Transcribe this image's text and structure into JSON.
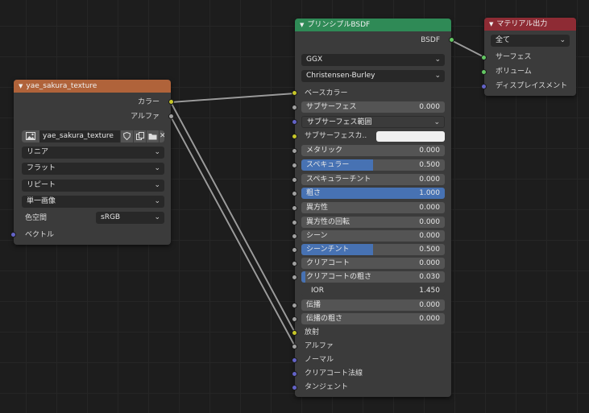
{
  "image_node": {
    "title": "yae_sakura_texture",
    "header_color": "#b0633a",
    "out_color": "カラー",
    "out_alpha": "アルファ",
    "image_name": "yae_sakura_texture",
    "interpolation": "リニア",
    "projection": "フラット",
    "extension": "リピート",
    "source": "単一画像",
    "color_space_label": "色空間",
    "color_space": "sRGB",
    "in_vector": "ベクトル"
  },
  "bsdf_node": {
    "title": "プリンシプルBSDF",
    "header_color": "#2f8a56",
    "out_bsdf": "BSDF",
    "distribution": "GGX",
    "subsurface_method": "Christensen-Burley",
    "base_color": "ベースカラー",
    "subsurface": {
      "label": "サブサーフェス",
      "value": "0.000"
    },
    "subsurface_radius": "サブサーフェス範囲",
    "subsurface_color": "サブサーフェスカ..",
    "metallic": {
      "label": "メタリック",
      "value": "0.000"
    },
    "specular": {
      "label": "スペキュラー",
      "value": "0.500",
      "fill": 0.5
    },
    "specular_tint": {
      "label": "スペキュラーチント",
      "value": "0.000"
    },
    "roughness": {
      "label": "粗さ",
      "value": "1.000",
      "fill": 1.0
    },
    "anisotropic": {
      "label": "異方性",
      "value": "0.000"
    },
    "anisotropic_rotation": {
      "label": "異方性の回転",
      "value": "0.000"
    },
    "sheen": {
      "label": "シーン",
      "value": "0.000"
    },
    "sheen_tint": {
      "label": "シーンチント",
      "value": "0.500",
      "fill": 0.5
    },
    "clearcoat": {
      "label": "クリアコート",
      "value": "0.000"
    },
    "clearcoat_roughness": {
      "label": "クリアコートの粗さ",
      "value": "0.030",
      "fill": 0.03
    },
    "ior": {
      "label": "IOR",
      "value": "1.450"
    },
    "transmission": {
      "label": "伝播",
      "value": "0.000"
    },
    "transmission_roughness": {
      "label": "伝播の粗さ",
      "value": "0.000"
    },
    "emission": "放射",
    "alpha": "アルファ",
    "normal": "ノーマル",
    "clearcoat_normal": "クリアコート法線",
    "tangent": "タンジェント"
  },
  "output_node": {
    "title": "マテリアル出力",
    "header_color": "#8e2b34",
    "target": "全て",
    "surface": "サーフェス",
    "volume": "ボリューム",
    "displacement": "ディスプレイスメント"
  },
  "icons": {
    "collapse": "collapse-triangle-icon",
    "image": "image-browse-icon",
    "fake_user": "fake-user-shield-icon",
    "duplicate": "duplicate-icon",
    "open": "folder-icon",
    "unlink": "close-icon",
    "dropdown": "chevron-down-icon"
  },
  "colors": {
    "background": "#1d1d1d",
    "node_body": "#3b3b3b",
    "field": "#545454",
    "field_fill": "#4772b3",
    "socket_color": "#c7c729",
    "socket_float": "#a1a1a1",
    "socket_vector": "#6363c7",
    "socket_shader": "#63c763"
  }
}
